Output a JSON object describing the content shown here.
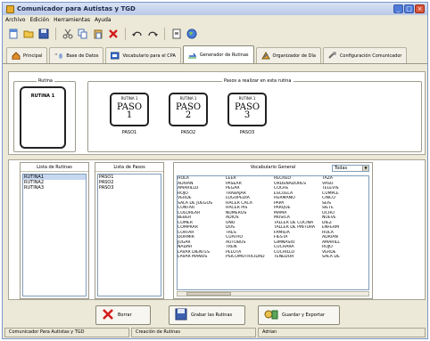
{
  "window": {
    "title": "Comunicador para Autistas y TGD"
  },
  "menu": [
    "Archivo",
    "Edición",
    "Herramientas",
    "Ayuda"
  ],
  "toolbar_icons": [
    "new-icon",
    "open-folder-icon",
    "save-icon",
    "cut-icon",
    "copy-icon",
    "paste-icon",
    "delete-icon",
    "undo-icon",
    "redo-icon",
    "page-icon",
    "help-globe-icon"
  ],
  "tabs": [
    {
      "label": "Principal",
      "icon": "home-icon"
    },
    {
      "label": "Base de Datos",
      "icon": "database-icon"
    },
    {
      "label": "Vocabulario para el CPA",
      "icon": "vocabulary-icon"
    },
    {
      "label": "Generador de Rutinas",
      "icon": "generator-icon",
      "active": true
    },
    {
      "label": "Organizador de Día",
      "icon": "organizer-icon"
    },
    {
      "label": "Configuración Comunicador",
      "icon": "settings-icon"
    }
  ],
  "routine_panel": {
    "rutina_label": "Rutina",
    "rutina_title": "RUTINA 1",
    "pasos_label": "Pasos a realizar en esta rutina",
    "steps": [
      {
        "header": "RUTINA 1",
        "big": "PASO",
        "num": "1",
        "caption": "PASO1"
      },
      {
        "header": "RUTINA 1",
        "big": "PASO",
        "num": "2",
        "caption": "PASO2"
      },
      {
        "header": "RUTINA 1",
        "big": "PASO",
        "num": "3",
        "caption": "PASO3"
      }
    ]
  },
  "rutinas_list": {
    "header": "Lista de Rutinas",
    "items": [
      "RUTINA1",
      "RUTINA2",
      "RUTINA3"
    ],
    "selected": 0
  },
  "pasos_list": {
    "header": "Lista de Pasos",
    "items": [
      "PASO1",
      "PASO2",
      "PASO3"
    ]
  },
  "vocabulary": {
    "header": "Vocabulario General",
    "filter": "Todas",
    "columns": [
      [
        "HOLA",
        "ADIVAN",
        "AMARILLO",
        "ROJO",
        "VERDE",
        "SALA DE JUEGOS",
        "CONTAR",
        "COLOREAR",
        "BEBER",
        "COMER",
        "COMPRAR",
        "CORTAR",
        "DORMIR",
        "JUGAR",
        "NADAR",
        "LAVAR DIENTES",
        "LAVAR MANOS"
      ],
      [
        "LEER",
        "PASEAR",
        "PEGAR",
        "TRABAJAR",
        "LOGOPEDIA",
        "HACER CACA",
        "HACER PIS",
        "NUMEROS",
        "ADIOS",
        "UNO",
        "DOS",
        "TRES",
        "CUATRO",
        "AUTOBUS",
        "TREN",
        "PELOTA",
        "PSICOMOTRICIDAD"
      ],
      [
        "RECREO",
        "ORDENADORES",
        "COCHE",
        "ESCUELA",
        "HERMANO",
        "PAPA",
        "PARQUE",
        "MAMA",
        "MUSICA",
        "TALLER DE COCINA",
        "TALLER DE PINTURA",
        "FAMILIA",
        "FIESTA",
        "GIMNASIO",
        "CUCHARA",
        "CUCHILLO",
        "TENEDOR"
      ],
      [
        "TAZA",
        "VASO",
        "TELEVIS",
        "CUMPLE",
        "CINCO",
        "SEIS",
        "SIETE",
        "OCHO",
        "NUEVE",
        "DIEZ",
        "ENFERM",
        "HOLA",
        "ADRIAN",
        "AMARILL",
        "ROJO",
        "VERDE",
        "SALA DE"
      ]
    ]
  },
  "buttons": {
    "borrar": "Borrar",
    "grabar": "Grabar las Rutinas",
    "guardar": "Guardar y Exportar"
  },
  "statusbar": [
    "Comunicador Para Autistas y TGD",
    "Creación de Rutinas",
    "Adrian"
  ]
}
